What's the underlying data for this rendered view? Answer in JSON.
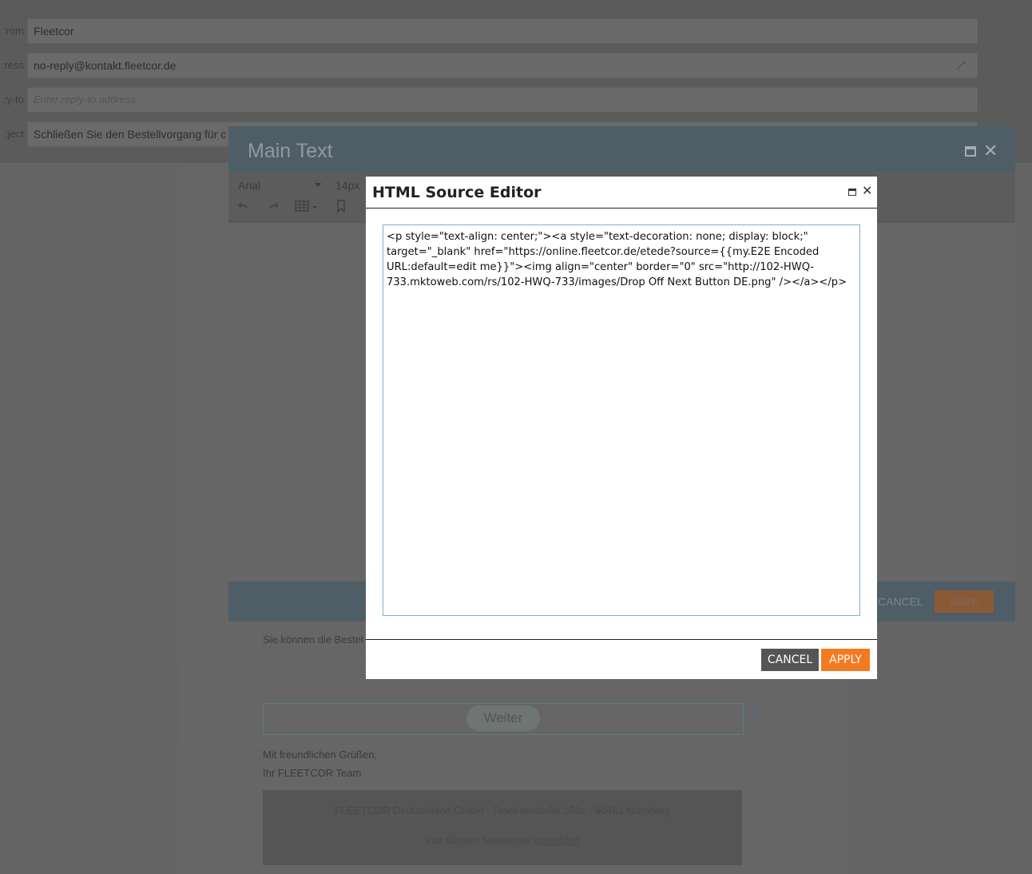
{
  "email_settings": {
    "from_label": "rom:",
    "from_value": "Fleetcor",
    "address_label": "ress:",
    "address_value": "no-reply@kontakt.fleetcor.de",
    "reply_to_label": "y-to:",
    "reply_to_placeholder": "Enter reply-to address",
    "subject_label": "ject:",
    "subject_value": "Schließen Sie den Bestellvorgang für c"
  },
  "email_body": {
    "intro_text": "Sie können die Bestel",
    "button_label": "Weiter",
    "greeting_line1": "Mit freundlichen Grüßen,",
    "greeting_line2": "Ihr FLEETCOR Team",
    "footer_address": "FLEETCOR Deutschland GmbH · Frankenstraße 150c · 90461 Nürnberg",
    "footer_unsubscribe_prefix": "Von diesem Newsletter ",
    "footer_unsubscribe_link": "abmelden"
  },
  "main_text_dialog": {
    "title": "Main Text",
    "font_family": "Arial",
    "font_size": "14px",
    "cancel_label": "CANCEL",
    "save_label": "SAVE"
  },
  "html_source_editor": {
    "title": "HTML Source Editor",
    "source": "<p style=\"text-align: center;\"><a style=\"text-decoration: none; display: block;\" target=\"_blank\" href=\"https://online.fleetcor.de/etede?source={{my.E2E Encoded URL:default=edit me}}\"><img align=\"center\" border=\"0\" src=\"http://102-HWQ-733.mktoweb.com/rs/102-HWQ-733/images/Drop Off Next Button DE.png\" /></a></p>",
    "cancel_label": "CANCEL",
    "apply_label": "APPLY"
  },
  "colors": {
    "accent_orange": "#f47a20",
    "cancel_gray": "#555555",
    "dialog_header": "#4f5d67"
  },
  "icons": [
    "restore-window-icon",
    "close-icon",
    "undo-icon",
    "redo-icon",
    "table-icon",
    "bookmark-icon",
    "lock-icon",
    "dropdown-caret-icon"
  ]
}
